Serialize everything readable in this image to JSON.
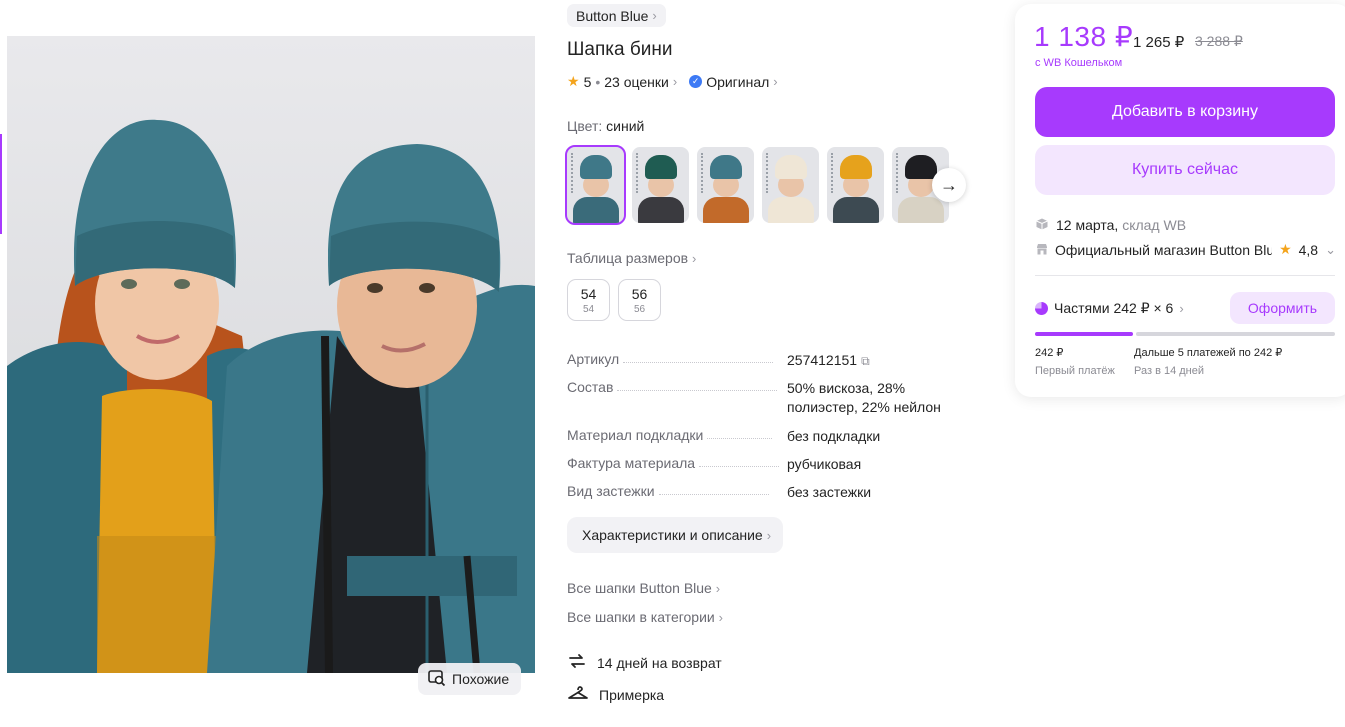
{
  "gallery": {
    "similar_label": "Похожие"
  },
  "product": {
    "brand": "Button Blue",
    "title": "Шапка бини",
    "rating": "5",
    "reviews": "23 оценки",
    "original_label": "Оригинал",
    "color_label": "Цвет:",
    "color_value": "синий",
    "size_table_label": "Таблица размеров",
    "sizes": [
      {
        "size": "54",
        "sub": "54"
      },
      {
        "size": "56",
        "sub": "56"
      }
    ],
    "thumbnails": [
      {
        "hat": "#3f7888",
        "body": "#3a6b7a"
      },
      {
        "hat": "#1f5c52",
        "body": "#3a3a3f"
      },
      {
        "hat": "#3f7888",
        "body": "#c26a2a"
      },
      {
        "hat": "#efe6d6",
        "body": "#efe6d6"
      },
      {
        "hat": "#e6a21c",
        "body": "#3d4a52"
      },
      {
        "hat": "#1e1e22",
        "body": "#d8d2c4"
      }
    ],
    "specs": [
      {
        "key": "Артикул",
        "value": "257412151"
      },
      {
        "key": "Состав",
        "value": "50% вискоза, 28% полиэстер, 22% нейлон"
      },
      {
        "key": "Материал подкладки",
        "value": "без подкладки"
      },
      {
        "key": "Фактура материала",
        "value": "рубчиковая"
      },
      {
        "key": "Вид застежки",
        "value": "без застежки"
      }
    ],
    "desc_button": "Характеристики и описание",
    "all_brand_link": "Все шапки Button Blue",
    "all_category_link": "Все шапки в категории",
    "return_label": "14 дней на возврат",
    "fitting_label": "Примерка"
  },
  "buy": {
    "price": "1 138 ₽",
    "price_regular": "1 265 ₽",
    "price_old": "3 288 ₽",
    "wallet_note": "с WB Кошельком",
    "cart_button": "Добавить в корзину",
    "buy_now_button": "Купить сейчас",
    "delivery_date": "12 марта,",
    "delivery_where": "склад WB",
    "shop_name": "Официальный магазин Button Blue",
    "shop_rating": "4,8",
    "installment_label": "Частями 242 ₽ × 6",
    "installment_button": "Оформить",
    "first_payment": "242 ₽",
    "first_payment_label": "Первый платёж",
    "next_payments": "Дальше 5 платежей по 242 ₽",
    "next_payments_label": "Раз в 14 дней"
  },
  "colors": {
    "accent": "#a73afd",
    "accent_light": "#f3e6fe"
  }
}
